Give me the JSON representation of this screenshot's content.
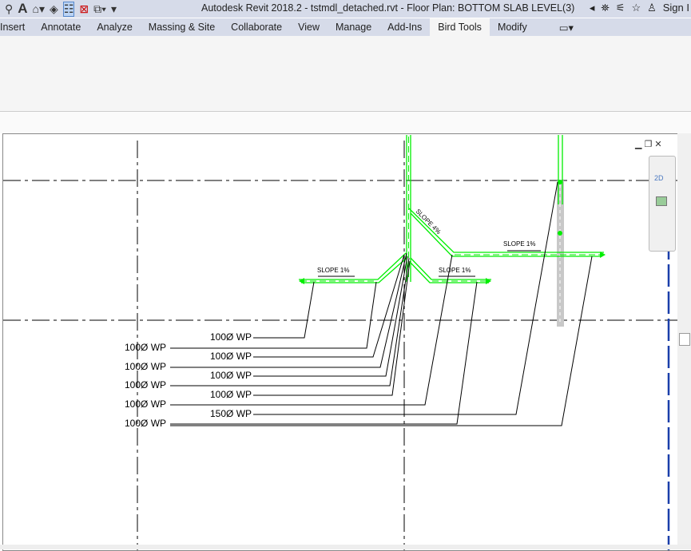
{
  "app": {
    "title": "Autodesk Revit 2018.2 -    tstmdl_detached.rvt - Floor Plan: BOTTOM SLAB LEVEL(3)",
    "sign_in": "Sign I"
  },
  "tabs": [
    {
      "label": "Insert"
    },
    {
      "label": "Annotate"
    },
    {
      "label": "Analyze"
    },
    {
      "label": "Massing & Site"
    },
    {
      "label": "Collaborate"
    },
    {
      "label": "View"
    },
    {
      "label": "Manage"
    },
    {
      "label": "Add-Ins"
    },
    {
      "label": "Bird Tools",
      "active": true
    },
    {
      "label": "Modify"
    },
    {
      "label": "▭▾"
    }
  ],
  "colors": {
    "pipe": "#00ee00",
    "grid": "#000000",
    "blue_line": "#1a3faa",
    "riser": "#c8c8c8"
  },
  "drawing": {
    "slopes": [
      "SLOPE 1%",
      "SLOPE 4%",
      "SLOPE 1%",
      "SLOPE 1%"
    ],
    "tags_right": [
      "100Ø WP",
      "100Ø WP",
      "100Ø WP",
      "100Ø WP",
      "150Ø WP"
    ],
    "tags_left": [
      "100Ø WP",
      "100Ø WP",
      "100Ø WP",
      "100Ø WP",
      "100Ø WP"
    ]
  },
  "view_controls": {
    "minimize": "▁",
    "restore": "❐",
    "close": "✕",
    "nav_2d": "2D"
  }
}
